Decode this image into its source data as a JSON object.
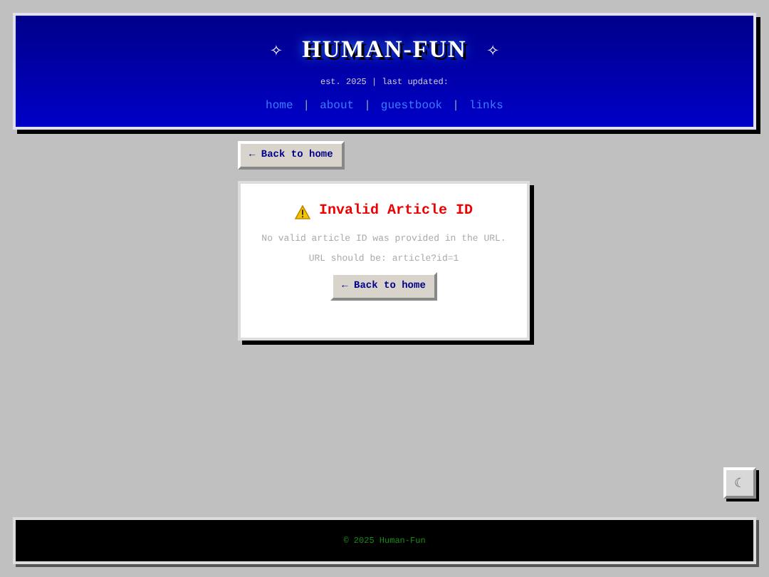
{
  "header": {
    "title": "HUMAN-FUN",
    "sparkle_left": "✧",
    "sparkle_right": "✧",
    "tagline": "est. 2025 | last updated:",
    "nav": [
      "home",
      "about",
      "guestbook",
      "links"
    ],
    "separator": "|"
  },
  "back_button": "← Back to home",
  "error_card": {
    "title": "Invalid Article ID",
    "message": "No valid article ID was provided in the URL.",
    "hint": "URL should be: article?id=1",
    "button": "← Back to home"
  },
  "theme_toggle": "☾",
  "footer": "© 2025 Human-Fun"
}
